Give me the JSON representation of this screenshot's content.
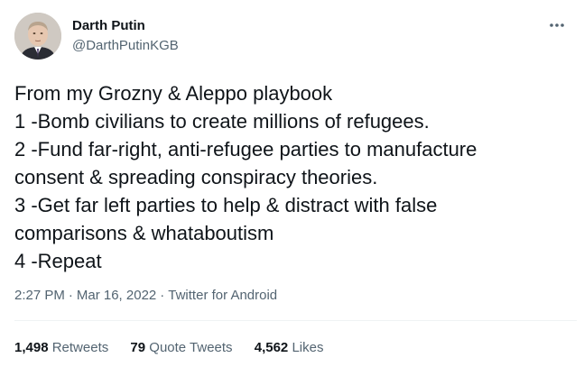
{
  "user": {
    "display_name": "Darth Putin",
    "handle": "@DarthPutinKGB"
  },
  "tweet": {
    "lines": [
      "From my Grozny & Aleppo playbook",
      "1 -Bomb civilians to create millions of refugees.",
      "2 -Fund far-right, anti-refugee parties to manufacture",
      "consent & spreading conspiracy theories.",
      "3 -Get far left parties to help & distract with false",
      "comparisons & whataboutism",
      "4 -Repeat"
    ]
  },
  "meta": {
    "time": "2:27 PM",
    "separator": "·",
    "date": "Mar 16, 2022",
    "source": "Twitter for Android"
  },
  "stats": {
    "retweets": {
      "count": "1,498",
      "label": "Retweets"
    },
    "quote_tweets": {
      "count": "79",
      "label": "Quote Tweets"
    },
    "likes": {
      "count": "4,562",
      "label": "Likes"
    }
  },
  "icons": {
    "more": "more-dots-icon"
  },
  "colors": {
    "text_primary": "#0f1419",
    "text_secondary": "#536471",
    "divider": "#eff3f4"
  }
}
